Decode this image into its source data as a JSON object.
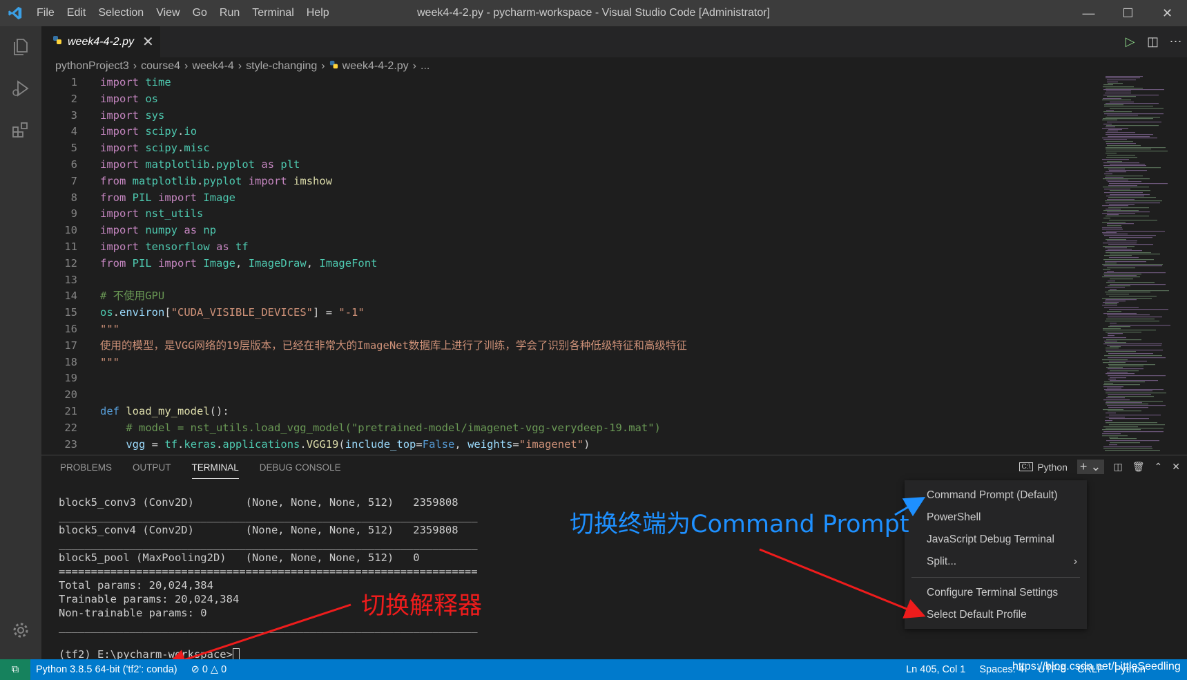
{
  "title_bar": {
    "menu": [
      "File",
      "Edit",
      "Selection",
      "View",
      "Go",
      "Run",
      "Terminal",
      "Help"
    ],
    "title": "week4-4-2.py - pycharm-workspace - Visual Studio Code [Administrator]"
  },
  "tab": {
    "label": "week4-4-2.py"
  },
  "breadcrumb": [
    "pythonProject3",
    "course4",
    "week4-4",
    "style-changing",
    "week4-4-2.py",
    "..."
  ],
  "code_lines": [
    {
      "n": "1",
      "t": "import time"
    },
    {
      "n": "2",
      "t": "import os"
    },
    {
      "n": "3",
      "t": "import sys"
    },
    {
      "n": "4",
      "t": "import scipy.io"
    },
    {
      "n": "5",
      "t": "import scipy.misc"
    },
    {
      "n": "6",
      "t": "import matplotlib.pyplot as plt"
    },
    {
      "n": "7",
      "t": "from matplotlib.pyplot import imshow"
    },
    {
      "n": "8",
      "t": "from PIL import Image"
    },
    {
      "n": "9",
      "t": "import nst_utils"
    },
    {
      "n": "10",
      "t": "import numpy as np"
    },
    {
      "n": "11",
      "t": "import tensorflow as tf"
    },
    {
      "n": "12",
      "t": "from PIL import Image, ImageDraw, ImageFont"
    },
    {
      "n": "13",
      "t": ""
    },
    {
      "n": "14",
      "t": "# 不使用GPU"
    },
    {
      "n": "15",
      "t": "os.environ[\"CUDA_VISIBLE_DEVICES\"] = \"-1\""
    },
    {
      "n": "16",
      "t": "\"\"\""
    },
    {
      "n": "17",
      "t": "使用的模型，是VGG网络的19层版本，已经在非常大的ImageNet数据库上进行了训练，学会了识别各种低级特征和高级特征"
    },
    {
      "n": "18",
      "t": "\"\"\""
    },
    {
      "n": "19",
      "t": ""
    },
    {
      "n": "20",
      "t": ""
    },
    {
      "n": "21",
      "t": "def load_my_model():"
    },
    {
      "n": "22",
      "t": "    # model = nst_utils.load_vgg_model(\"pretrained-model/imagenet-vgg-verydeep-19.mat\")"
    },
    {
      "n": "23",
      "t": "    vgg = tf.keras.applications.VGG19(include_top=False, weights=\"imagenet\")"
    }
  ],
  "panel": {
    "tabs": [
      "PROBLEMS",
      "OUTPUT",
      "TERMINAL",
      "DEBUG CONSOLE"
    ],
    "active_tab": "TERMINAL",
    "shell_label": "Python"
  },
  "terminal_lines": [
    "block5_conv3 (Conv2D)        (None, None, None, 512)   2359808",
    "_________________________________________________________________",
    "block5_conv4 (Conv2D)        (None, None, None, 512)   2359808",
    "_________________________________________________________________",
    "block5_pool (MaxPooling2D)   (None, None, None, 512)   0",
    "=================================================================",
    "Total params: 20,024,384",
    "Trainable params: 20,024,384",
    "Non-trainable params: 0",
    "_________________________________________________________________",
    "",
    "(tf2) E:\\pycharm-workspace>"
  ],
  "dropdown": {
    "items": [
      "Command Prompt (Default)",
      "PowerShell",
      "JavaScript Debug Terminal",
      "Split..."
    ],
    "items2": [
      "Configure Terminal Settings",
      "Select Default Profile"
    ]
  },
  "annotations": {
    "blue": "切换终端为Command Prompt",
    "red": "切换解释器"
  },
  "status_bar": {
    "interpreter": "Python 3.8.5 64-bit ('tf2': conda)",
    "errors": "0",
    "warnings": "0",
    "position": "Ln 405, Col 1",
    "spaces": "Spaces: 4",
    "encoding": "UTF-8",
    "eol": "CRLF",
    "language": "Python"
  },
  "watermark": "https://blog.csdn.net/LittleSeedling"
}
